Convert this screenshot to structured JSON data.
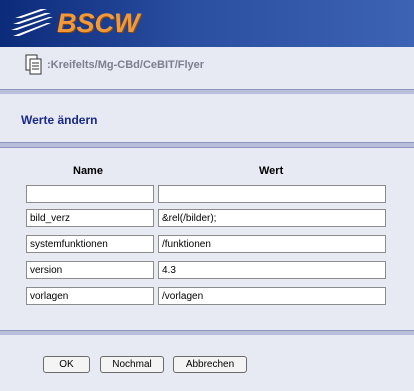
{
  "header": {
    "logo_text": "BSCW",
    "colors": {
      "header_bg": "#1e3a8a",
      "logo_orange": "#f29a3a"
    }
  },
  "path": {
    "icon": "documents-icon",
    "text": ":Kreifelts/Mg-CBd/CeBIT/Flyer"
  },
  "form": {
    "title": "Werte ändern",
    "columns": {
      "name": "Name",
      "value": "Wert"
    },
    "rows": [
      {
        "name": "",
        "value": ""
      },
      {
        "name": "bild_verz",
        "value": "&rel(/bilder);"
      },
      {
        "name": "systemfunktionen",
        "value": "/funktionen"
      },
      {
        "name": "version",
        "value": "4.3"
      },
      {
        "name": "vorlagen",
        "value": "/vorlagen"
      }
    ]
  },
  "buttons": {
    "ok": "OK",
    "reset": "Nochmal",
    "cancel": "Abbrechen"
  }
}
